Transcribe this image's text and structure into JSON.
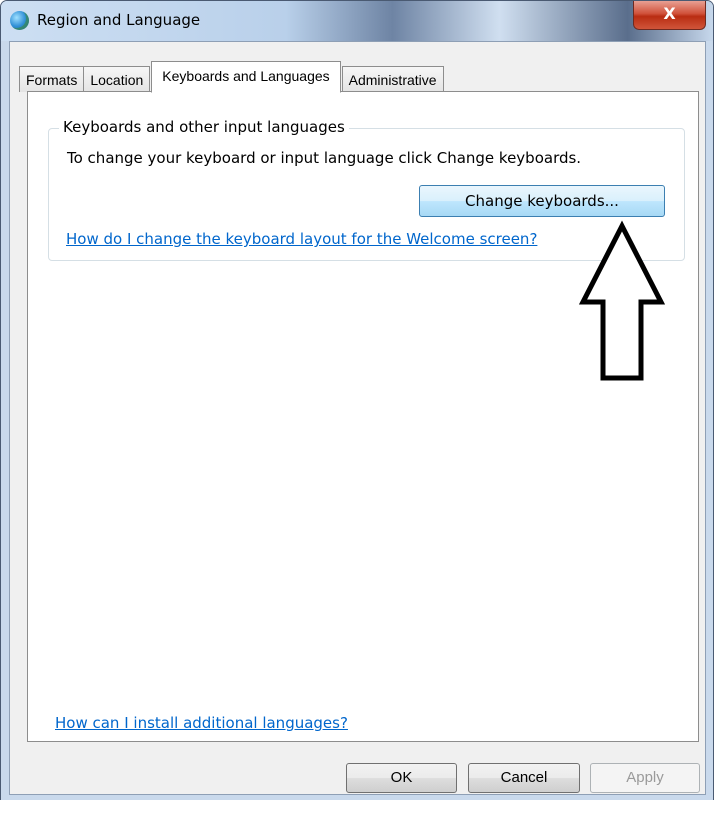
{
  "window": {
    "title": "Region and Language",
    "close_label": "X"
  },
  "tabs": [
    {
      "label": "Formats",
      "active": false
    },
    {
      "label": "Location",
      "active": false
    },
    {
      "label": "Keyboards and Languages",
      "active": true
    },
    {
      "label": "Administrative",
      "active": false
    }
  ],
  "keyboards_group": {
    "title": "Keyboards and other input languages",
    "description": "To change your keyboard or input language click Change keyboards.",
    "change_button": "Change keyboards...",
    "welcome_link": "How do I change the keyboard layout for the Welcome screen?"
  },
  "install_link": "How can I install additional languages?",
  "buttons": {
    "ok": "OK",
    "cancel": "Cancel",
    "apply": "Apply"
  },
  "annotation": {
    "icon": "up-arrow-icon",
    "color": "#000000"
  },
  "colors": {
    "link": "#0066cc",
    "focus_button_border": "#3c7fb1",
    "close_button": "#c7432a"
  }
}
